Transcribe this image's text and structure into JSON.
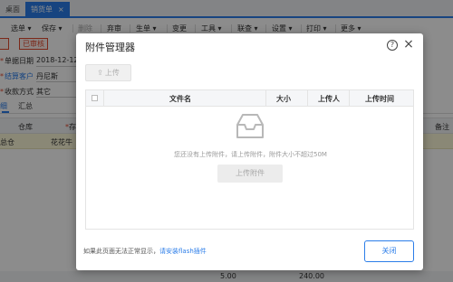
{
  "tabs": [
    {
      "label": "桌面"
    },
    {
      "label": "销货单",
      "close": "×"
    }
  ],
  "toolbar": {
    "items": [
      {
        "label": "选单 ▾"
      },
      {
        "label": "保存 ▾"
      },
      {
        "label": "删除"
      },
      {
        "label": "弃审"
      },
      {
        "label": "生单 ▾"
      },
      {
        "label": "变更"
      },
      {
        "label": "工具 ▾"
      },
      {
        "label": "联查 ▾"
      },
      {
        "label": "设置 ▾"
      },
      {
        "label": "打印 ▾"
      },
      {
        "label": "更多 ▾"
      }
    ]
  },
  "stamps": {
    "first": "",
    "second": "已审核"
  },
  "form": {
    "date_label": "单据日期",
    "date_value": "2018-12-12",
    "customer_label": "结算客户",
    "customer_value": "丹尼斯",
    "payment_label": "收款方式",
    "payment_value": "其它"
  },
  "subtabs": {
    "detail": "细",
    "summary": "汇总"
  },
  "grid": {
    "headers": {
      "warehouse": "仓库",
      "stock": "存",
      "remark": "备注"
    },
    "row": {
      "warehouse": "总仓",
      "item": "花花牛"
    },
    "footer": {
      "qty": "5.00",
      "amount": "240.00"
    }
  },
  "modal": {
    "title": "附件管理器",
    "help_icon": "?",
    "close_icon": "×",
    "upload_button": "上传",
    "columns": {
      "name": "文件名",
      "size": "大小",
      "uploader": "上传人",
      "time": "上传时间"
    },
    "empty_text": "您还没有上传附件，请上传附件，附件大小不超过50M",
    "empty_upload_button": "上传附件",
    "footer_note": "如果此页面无法正常显示，",
    "footer_link": "请安装flash插件",
    "close_button": "关闭"
  },
  "colors": {
    "accent": "#2b7de9",
    "stamp": "#e04a2f",
    "row_highlight": "#fbf7d8"
  }
}
